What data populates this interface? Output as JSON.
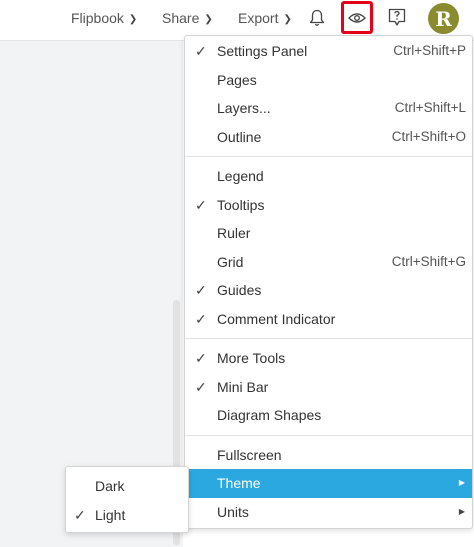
{
  "toolbar": {
    "flipbook_label": "Flipbook",
    "share_label": "Share",
    "export_label": "Export",
    "avatar_initial": "R",
    "icons": [
      "bell-icon",
      "eye-icon",
      "help-icon"
    ],
    "view_button_highlight": "#e3001b"
  },
  "view_menu": {
    "groups": [
      [
        {
          "label": "Settings Panel",
          "checked": true,
          "shortcut": "Ctrl+Shift+P"
        },
        {
          "label": "Pages",
          "checked": false,
          "shortcut": ""
        },
        {
          "label": "Layers...",
          "checked": false,
          "shortcut": "Ctrl+Shift+L"
        },
        {
          "label": "Outline",
          "checked": false,
          "shortcut": "Ctrl+Shift+O"
        }
      ],
      [
        {
          "label": "Legend",
          "checked": false,
          "shortcut": ""
        },
        {
          "label": "Tooltips",
          "checked": true,
          "shortcut": ""
        },
        {
          "label": "Ruler",
          "checked": false,
          "shortcut": ""
        },
        {
          "label": "Grid",
          "checked": false,
          "shortcut": "Ctrl+Shift+G"
        },
        {
          "label": "Guides",
          "checked": true,
          "shortcut": ""
        },
        {
          "label": "Comment Indicator",
          "checked": true,
          "shortcut": ""
        }
      ],
      [
        {
          "label": "More Tools",
          "checked": true,
          "shortcut": ""
        },
        {
          "label": "Mini Bar",
          "checked": true,
          "shortcut": ""
        },
        {
          "label": "Diagram Shapes",
          "checked": false,
          "shortcut": ""
        }
      ],
      [
        {
          "label": "Fullscreen",
          "checked": false,
          "shortcut": "",
          "submenu": false,
          "active": false
        },
        {
          "label": "Theme",
          "checked": false,
          "shortcut": "",
          "submenu": true,
          "active": true
        },
        {
          "label": "Units",
          "checked": false,
          "shortcut": "",
          "submenu": true,
          "active": false
        }
      ]
    ],
    "active_color": "#2ca8e0"
  },
  "theme_submenu": {
    "items": [
      {
        "label": "Dark",
        "checked": false
      },
      {
        "label": "Light",
        "checked": true
      }
    ]
  }
}
